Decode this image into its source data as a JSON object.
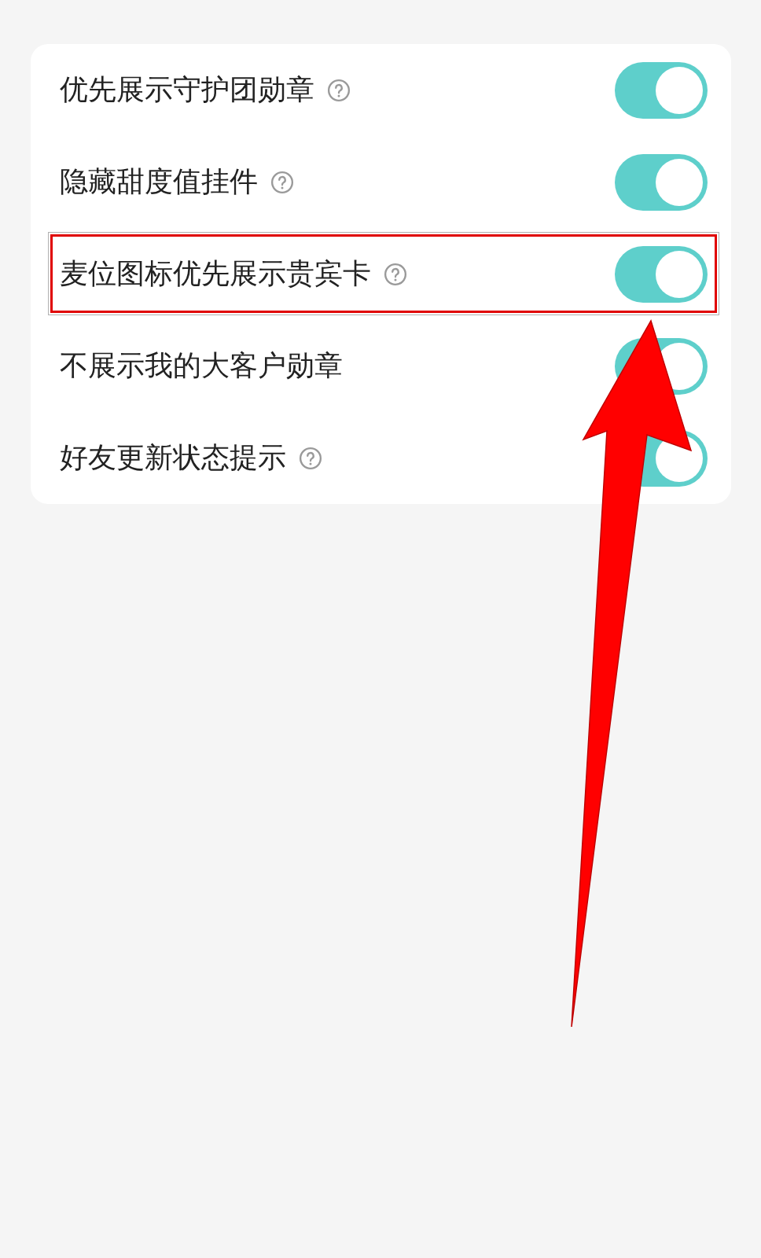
{
  "settings": [
    {
      "label": "优先展示守护团勋章",
      "help": true,
      "on": true,
      "highlighted": false
    },
    {
      "label": "隐藏甜度值挂件",
      "help": true,
      "on": true,
      "highlighted": false
    },
    {
      "label": "麦位图标优先展示贵宾卡",
      "help": true,
      "on": true,
      "highlighted": true
    },
    {
      "label": "不展示我的大客户勋章",
      "help": false,
      "on": true,
      "highlighted": false
    },
    {
      "label": "好友更新状态提示",
      "help": true,
      "on": true,
      "highlighted": false
    }
  ]
}
